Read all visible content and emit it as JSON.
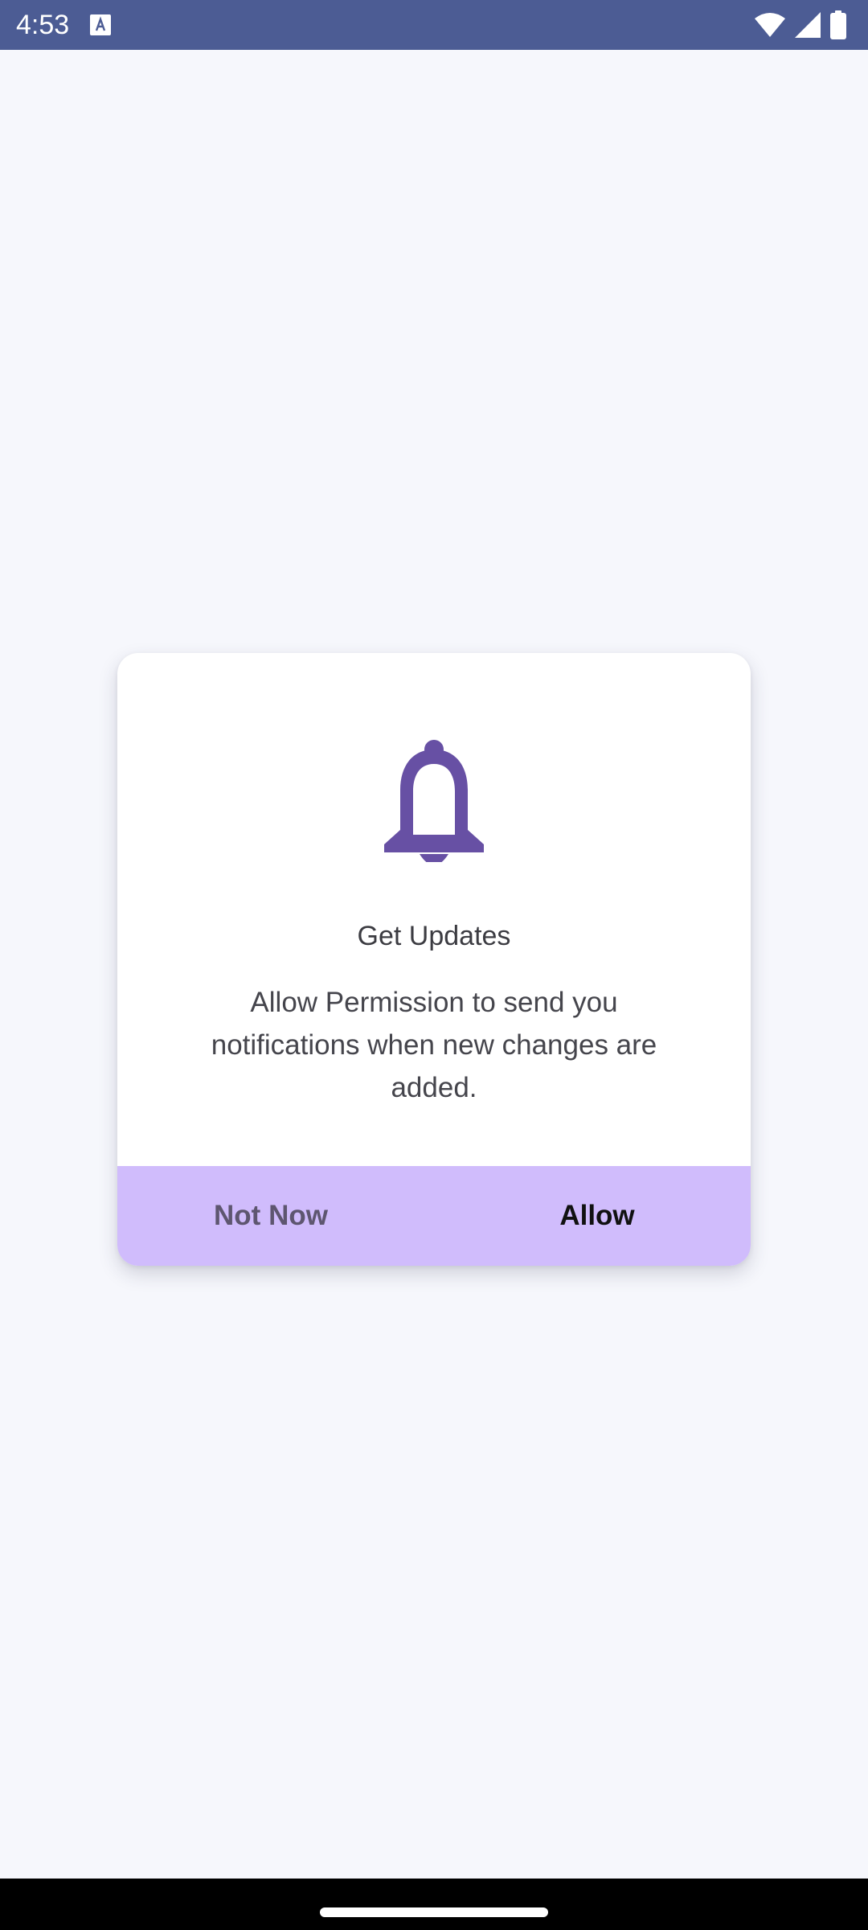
{
  "status_bar": {
    "time": "4:53",
    "background_color": "#4c5c94",
    "icons": [
      "keyboard-app-icon",
      "wifi-icon",
      "cellular-signal-icon",
      "battery-icon"
    ]
  },
  "dialog": {
    "icon": "bell-icon",
    "icon_color": "#6750a4",
    "title": "Get Updates",
    "message": "Allow Permission to send you notifications when new changes are added.",
    "actions": {
      "background_color": "#d0bcfc",
      "not_now_label": "Not Now",
      "allow_label": "Allow"
    }
  },
  "colors": {
    "page_background": "#f6f7fc",
    "dialog_background": "#ffffff",
    "nav_bar": "#000000"
  }
}
